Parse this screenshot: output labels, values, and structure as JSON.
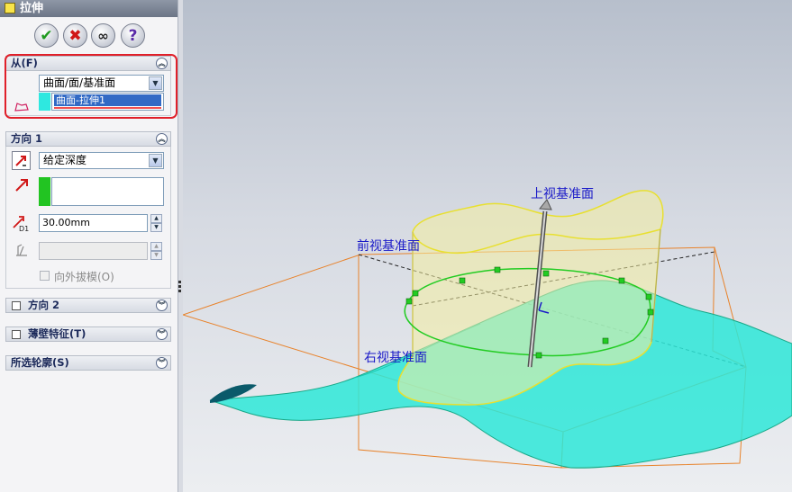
{
  "panel": {
    "title": "拉伸",
    "buttons": {
      "ok": "✔",
      "cancel": "✖",
      "preview": "∞",
      "help": "?"
    },
    "from_section": {
      "header": "从(F)",
      "combo_value": "曲面/面/基准面",
      "selected_item": "曲面-拉伸1"
    },
    "direction1": {
      "header": "方向 1",
      "end_condition": "给定深度",
      "depth": "30.00mm",
      "draft_outward_label": "向外拔模(O)"
    },
    "direction2": {
      "header": "方向 2"
    },
    "thin_feature": {
      "header": "薄壁特征(T)"
    },
    "selected_contours": {
      "header": "所选轮廓(S)"
    }
  },
  "viewport": {
    "labels": {
      "top_plane": "上视基准面",
      "front_plane": "前视基准面",
      "right_plane": "右视基准面"
    }
  },
  "colors": {
    "highlight_red": "#e0202a",
    "surface_cyan": "#2ee8d8",
    "preview_yellow": "#f4eea0",
    "plane_orange": "#e8822a",
    "label_blue": "#1a1ac8"
  }
}
